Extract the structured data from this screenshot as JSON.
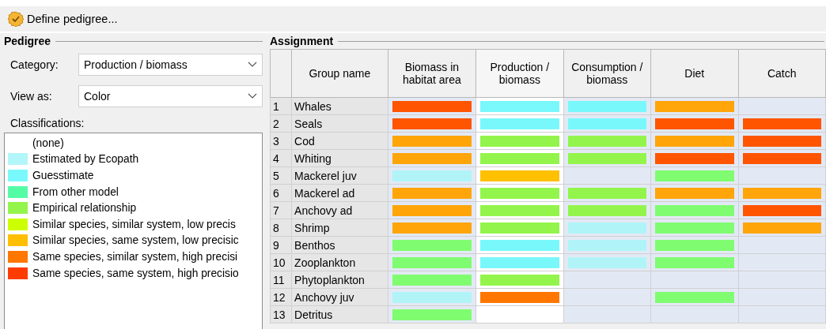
{
  "toolbar": {
    "button": "Define pedigree..."
  },
  "pedigree": {
    "title": "Pedigree",
    "category": {
      "label": "Category:",
      "value": "Production / biomass"
    },
    "view_as": {
      "label": "View as:",
      "value": "Color"
    },
    "classifications_label": "Classifications:",
    "classifications": [
      {
        "label": "(none)"
      },
      {
        "label": "Estimated by Ecopath",
        "color": "#b3f6f9"
      },
      {
        "label": "Guesstimate",
        "color": "#79f9fc"
      },
      {
        "label": "From other model",
        "color": "#55fca6"
      },
      {
        "label": "Empirical relationship",
        "color": "#93f54b"
      },
      {
        "label": "Similar species, similar system, low precis",
        "color": "#ccff00"
      },
      {
        "label": "Similar species, same system, low precisic",
        "color": "#ffbf00"
      },
      {
        "label": "Same species, similar system, high precisi",
        "color": "#ff7700"
      },
      {
        "label": "Same species, same system, high precisio",
        "color": "#ff3c00"
      }
    ]
  },
  "assignment": {
    "title": "Assignment",
    "columns": [
      {
        "label": "Group name",
        "selected": false
      },
      {
        "label": "Biomass in habitat area",
        "selected": false
      },
      {
        "label": "Production / biomass",
        "selected": true
      },
      {
        "label": "Consumption / biomass",
        "selected": false
      },
      {
        "label": "Diet",
        "selected": false
      },
      {
        "label": "Catch",
        "selected": false
      }
    ],
    "rows": [
      {
        "number": "1",
        "group": "Whales",
        "cells": [
          {
            "color": "#ff5500"
          },
          {
            "color": "#78f8fb"
          },
          {
            "color": "#78f8fb"
          },
          {
            "color": "#ffa50a"
          },
          {}
        ]
      },
      {
        "number": "2",
        "group": "Seals",
        "cells": [
          {
            "color": "#ff5500"
          },
          {
            "color": "#78f8fb"
          },
          {
            "color": "#78f8fb"
          },
          {
            "color": "#ff5500"
          },
          {
            "color": "#ff5500"
          }
        ]
      },
      {
        "number": "3",
        "group": "Cod",
        "cells": [
          {
            "color": "#ffa50a"
          },
          {
            "color": "#93f54b"
          },
          {
            "color": "#93f54b"
          },
          {
            "color": "#ffa50a"
          },
          {
            "color": "#ff5500"
          }
        ]
      },
      {
        "number": "4",
        "group": "Whiting",
        "cells": [
          {
            "color": "#ffa50a"
          },
          {
            "color": "#93f54b"
          },
          {
            "color": "#93f54b"
          },
          {
            "color": "#ff5500"
          },
          {
            "color": "#ff5500"
          }
        ]
      },
      {
        "number": "5",
        "group": "Mackerel juv",
        "cells": [
          {
            "color": "#b0f4f8"
          },
          {
            "color": "#ffc000"
          },
          {},
          {
            "color": "#80fc70"
          },
          {}
        ]
      },
      {
        "number": "6",
        "group": "Mackerel ad",
        "cells": [
          {
            "color": "#ffa50a"
          },
          {
            "color": "#93f54b"
          },
          {
            "color": "#93f54b"
          },
          {
            "color": "#ffa50a"
          },
          {
            "color": "#ffa50a"
          }
        ]
      },
      {
        "number": "7",
        "group": "Anchovy ad",
        "cells": [
          {
            "color": "#ffa50a"
          },
          {
            "color": "#93f54b"
          },
          {
            "color": "#93f54b"
          },
          {
            "color": "#80fc70"
          },
          {
            "color": "#ff5500"
          }
        ]
      },
      {
        "number": "8",
        "group": "Shrimp",
        "cells": [
          {
            "color": "#ffa50a"
          },
          {
            "color": "#93f54b"
          },
          {
            "color": "#b0f4f8"
          },
          {
            "color": "#80fc70"
          },
          {
            "color": "#ffa50a"
          }
        ]
      },
      {
        "number": "9",
        "group": "Benthos",
        "cells": [
          {
            "color": "#80fc70"
          },
          {
            "color": "#78f8fb"
          },
          {
            "color": "#b0f4f8"
          },
          {
            "color": "#80fc70"
          },
          {}
        ]
      },
      {
        "number": "10",
        "group": "Zooplankton",
        "cells": [
          {
            "color": "#80fc70"
          },
          {
            "color": "#78f8fb"
          },
          {
            "color": "#b0f4f8"
          },
          {
            "color": "#80fc70"
          },
          {}
        ]
      },
      {
        "number": "11",
        "group": "Phytoplankton",
        "cells": [
          {
            "color": "#80fc70"
          },
          {
            "color": "#93f54b"
          },
          {},
          {},
          {}
        ]
      },
      {
        "number": "12",
        "group": "Anchovy juv",
        "cells": [
          {
            "color": "#b0f4f8"
          },
          {
            "color": "#ff7700"
          },
          {},
          {
            "color": "#80fc70"
          },
          {}
        ]
      },
      {
        "number": "13",
        "group": "Detritus",
        "cells": [
          {
            "color": "#80fc70"
          },
          {},
          {},
          {},
          {}
        ]
      }
    ]
  }
}
